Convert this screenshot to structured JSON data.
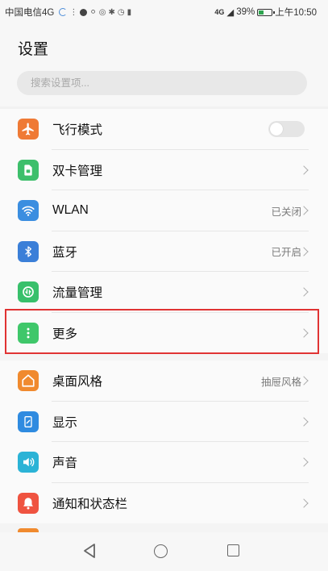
{
  "status_bar": {
    "carrier": "中国电信4G",
    "signal_text": "4G",
    "battery_percent": "39%",
    "battery_level": 0.39,
    "time": "上午10:50"
  },
  "header": {
    "title": "设置"
  },
  "search": {
    "placeholder": "搜索设置项..."
  },
  "colors": {
    "airplane": "#ef7a35",
    "dual_sim": "#3dbf6b",
    "wlan": "#3b8ee0",
    "bluetooth": "#3b7fd8",
    "data_usage": "#38c06b",
    "more": "#3fc76a",
    "theme": "#f08a2e",
    "display": "#2f8be0",
    "sound": "#2bb3d6",
    "notification": "#ef5340",
    "highlight": "#e03333"
  },
  "group1": [
    {
      "icon": "airplane-icon",
      "label": "飞行模式",
      "control": "toggle",
      "toggle_on": false
    },
    {
      "icon": "dual-sim-icon",
      "label": "双卡管理"
    },
    {
      "icon": "wifi-icon",
      "label": "WLAN",
      "value": "已关闭"
    },
    {
      "icon": "bluetooth-icon",
      "label": "蓝牙",
      "value": "已开启"
    },
    {
      "icon": "data-usage-icon",
      "label": "流量管理"
    },
    {
      "icon": "more-icon",
      "label": "更多"
    }
  ],
  "group2": [
    {
      "icon": "theme-icon",
      "label": "桌面风格",
      "value": "抽屉风格"
    },
    {
      "icon": "display-icon",
      "label": "显示"
    },
    {
      "icon": "sound-icon",
      "label": "声音"
    },
    {
      "icon": "notification-icon",
      "label": "通知和状态栏"
    }
  ],
  "nav": {
    "back": "back-icon",
    "home": "home-icon",
    "recent": "recent-apps-icon"
  }
}
